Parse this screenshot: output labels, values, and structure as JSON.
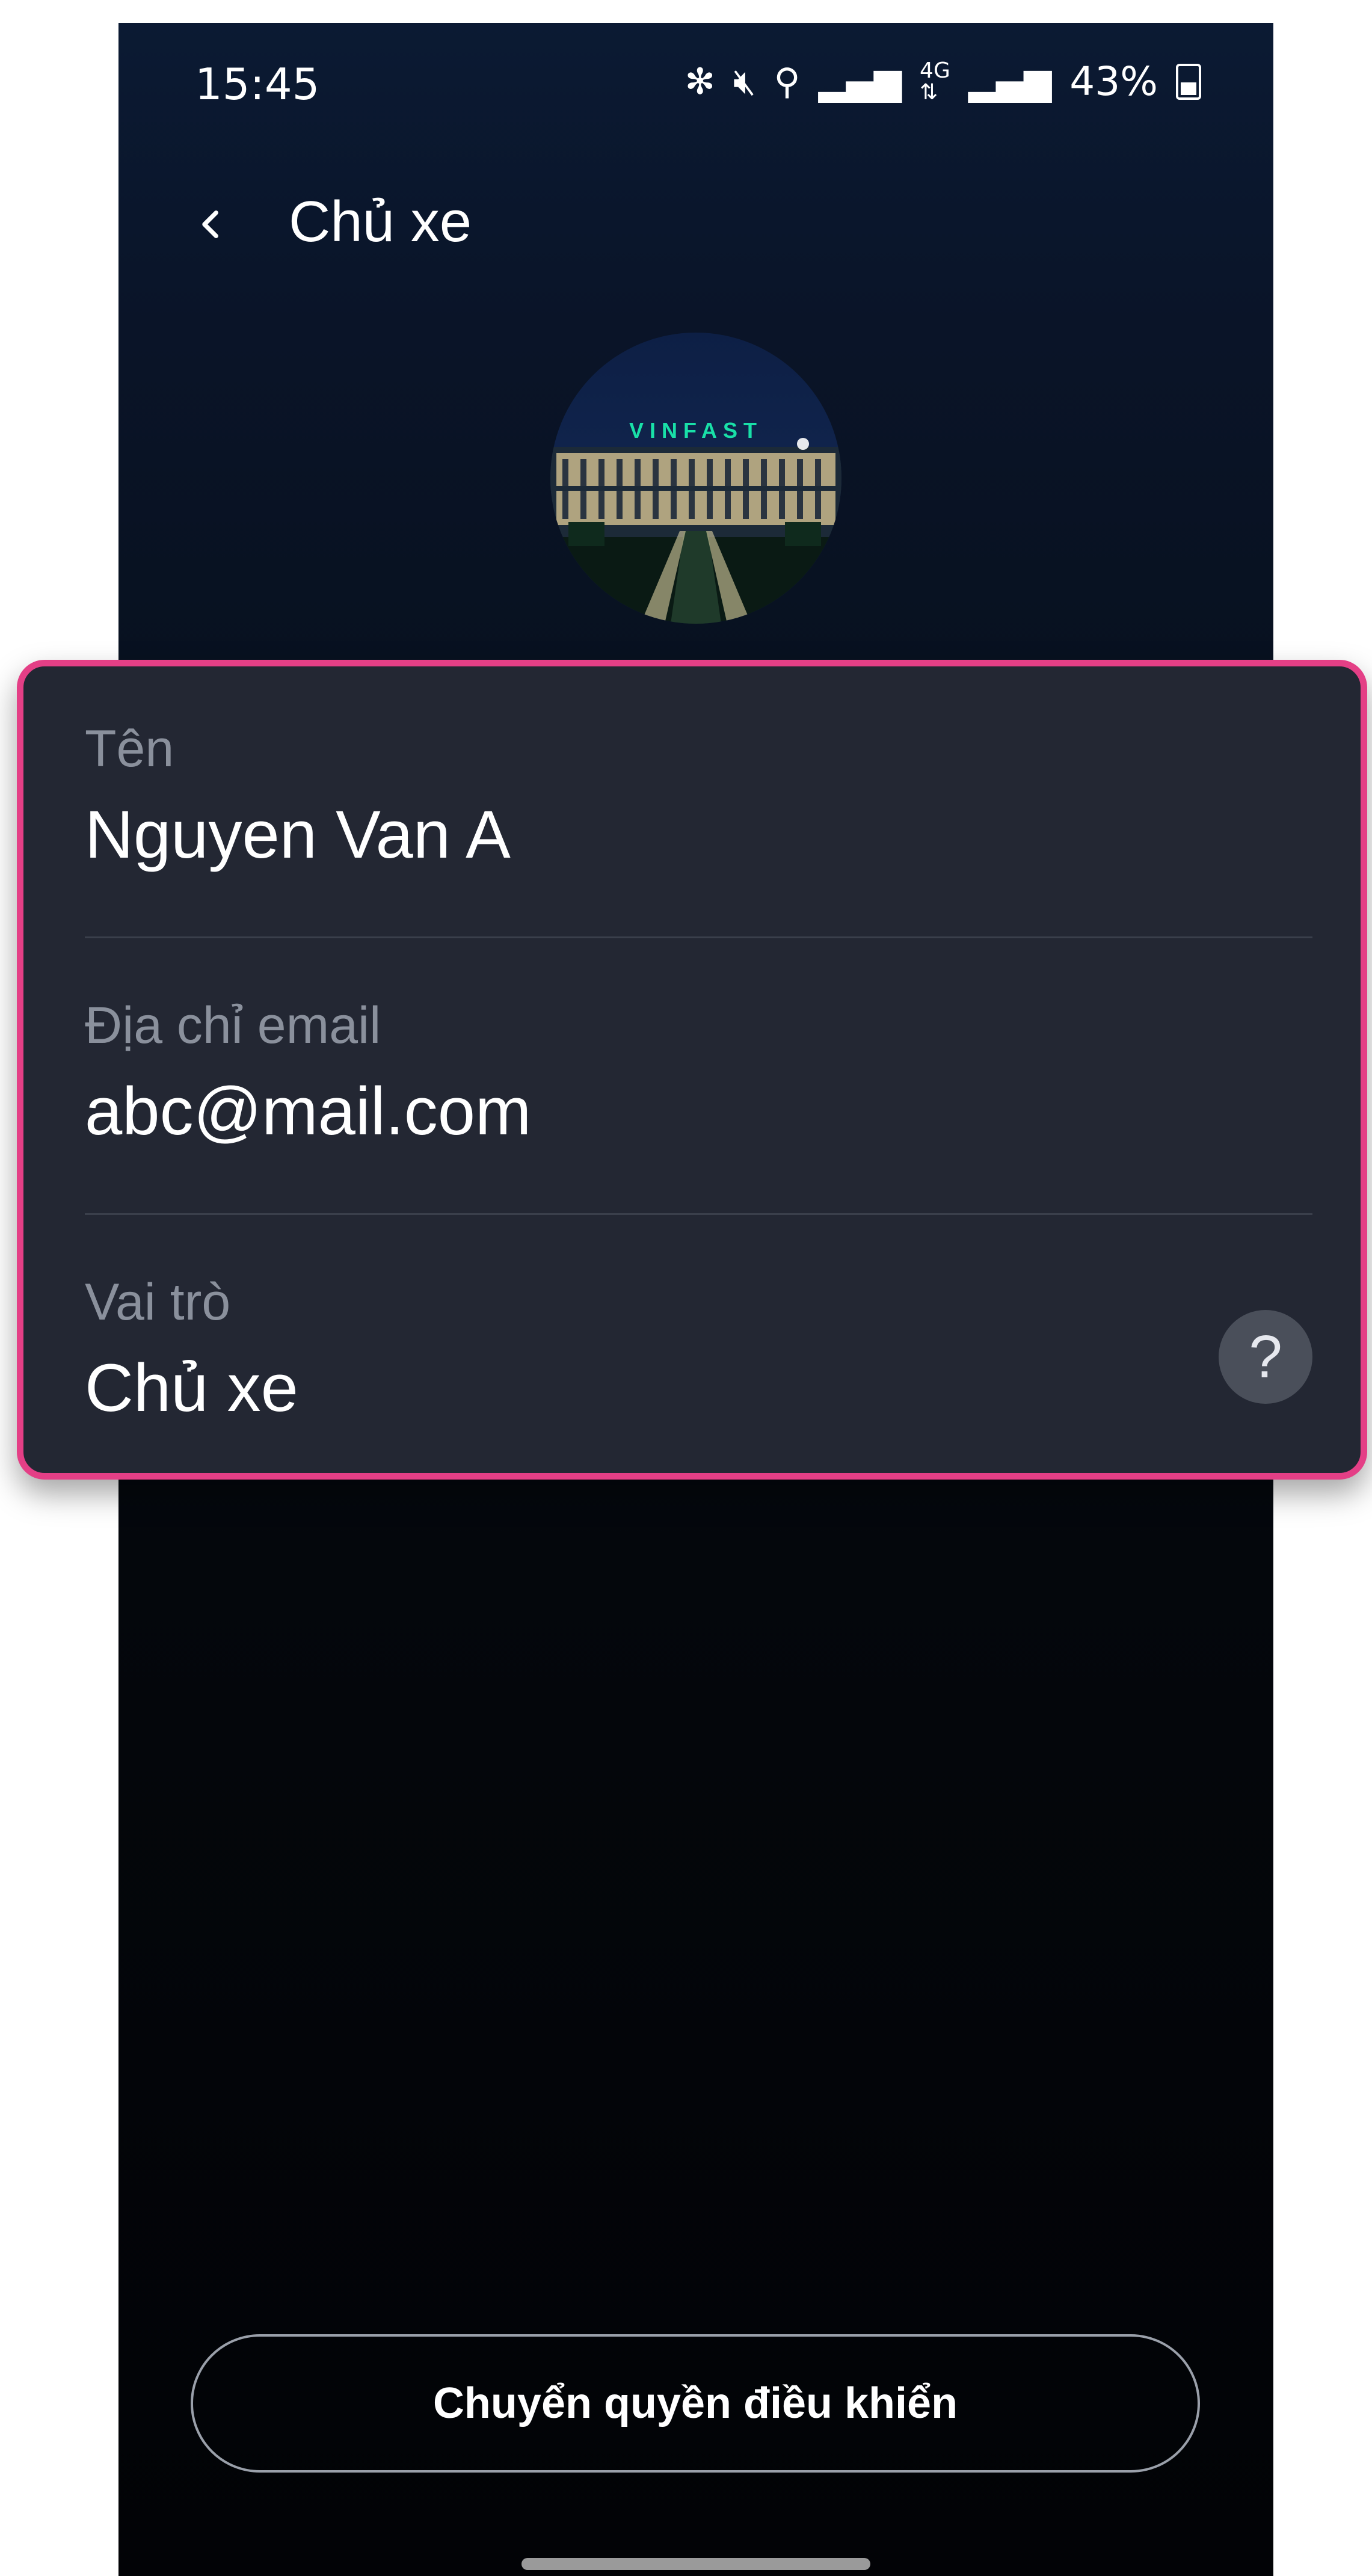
{
  "status_bar": {
    "time": "15:45",
    "icons": [
      "bluetooth-icon",
      "mute-icon",
      "location-icon",
      "signal-icon",
      "4g-icon",
      "signal-icon"
    ],
    "battery": "43%"
  },
  "header": {
    "back_icon": "chevron-left-icon",
    "title": "Chủ xe"
  },
  "avatar": {
    "sign_text": "VINFAST"
  },
  "info": {
    "name_label": "Tên",
    "name_value": "Nguyen Van A",
    "email_label": "Địa chỉ email",
    "email_value": "abc@mail.com",
    "role_label": "Vai trò",
    "role_value": "Chủ xe",
    "help_glyph": "?"
  },
  "actions": {
    "transfer_label": "Chuyển quyền điều khiển"
  },
  "colors": {
    "highlight_border": "#e43f86",
    "card_background": "#232733",
    "accent_sign": "#19e0a8"
  }
}
